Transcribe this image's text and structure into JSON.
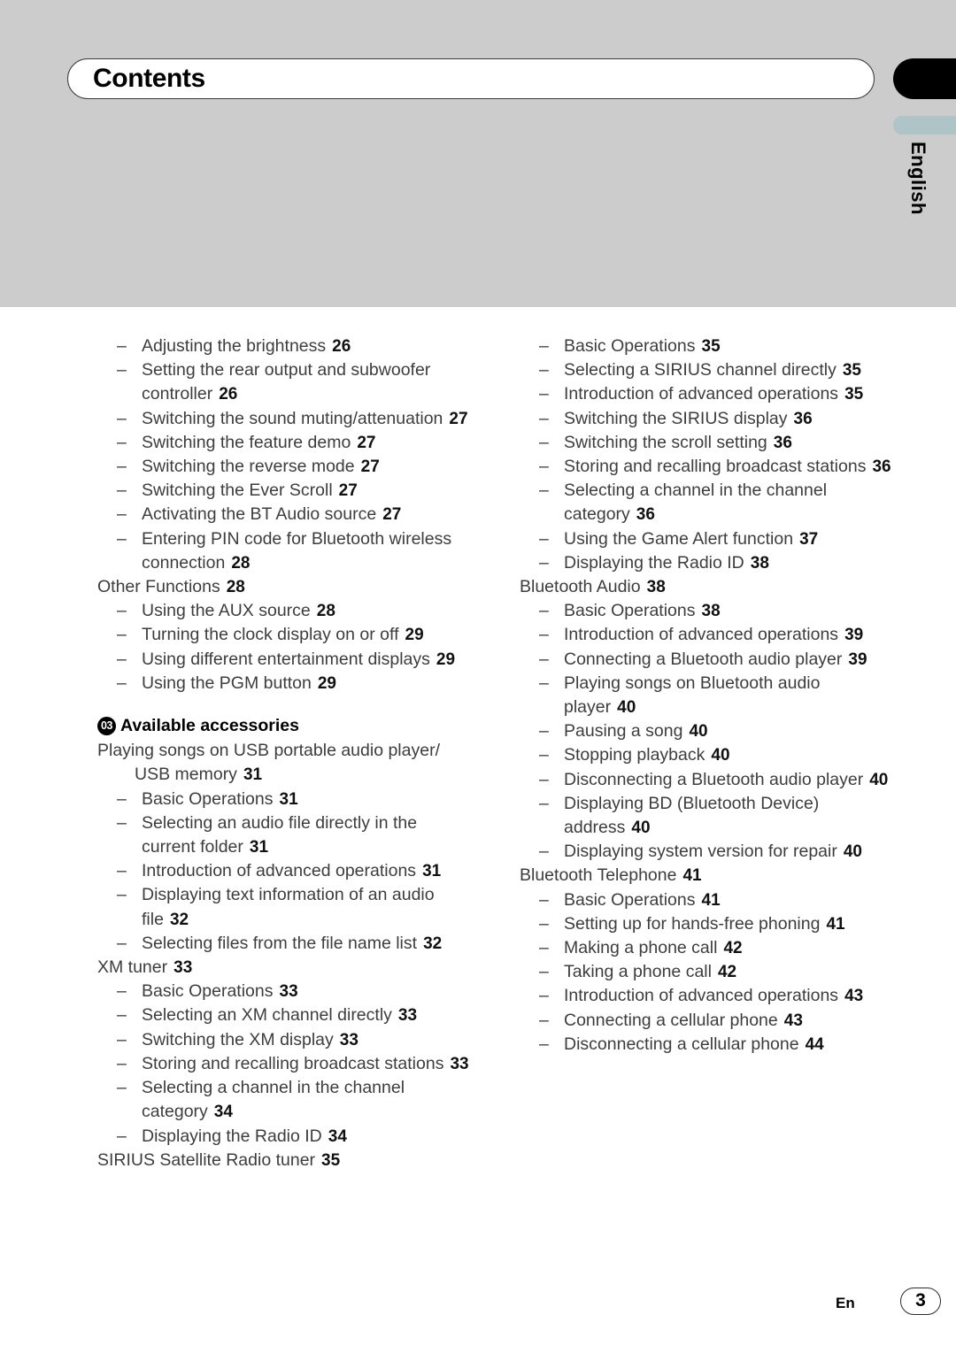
{
  "page": {
    "title": "Contents",
    "language_tab": "English",
    "footer_lang": "En",
    "footer_page": "3",
    "accent_black": "#000000",
    "accent_tab": "#aec4c6",
    "band_gray": "#cccccc"
  },
  "left_column": [
    {
      "level": 1,
      "text": "Adjusting the brightness",
      "page": "26"
    },
    {
      "level": 1,
      "text": "Setting the rear output and subwoofer controller",
      "page": "26"
    },
    {
      "level": 1,
      "text": "Switching the sound muting/attenuation",
      "page": "27"
    },
    {
      "level": 1,
      "text": "Switching the feature demo",
      "page": "27"
    },
    {
      "level": 1,
      "text": "Switching the reverse mode",
      "page": "27"
    },
    {
      "level": 1,
      "text": "Switching the Ever Scroll",
      "page": "27"
    },
    {
      "level": 1,
      "text": "Activating the BT Audio source",
      "page": "27"
    },
    {
      "level": 1,
      "text": "Entering PIN code for Bluetooth wireless connection",
      "page": "28"
    },
    {
      "level": 0,
      "text": "Other Functions",
      "page": "28"
    },
    {
      "level": 1,
      "text": "Using the AUX source",
      "page": "28"
    },
    {
      "level": 1,
      "text": "Turning the clock display on or off",
      "page": "29"
    },
    {
      "level": 1,
      "text": "Using different entertainment displays",
      "page": "29"
    },
    {
      "level": 1,
      "text": "Using the PGM button",
      "page": "29"
    },
    {
      "level": "chapter",
      "badge": "03",
      "text": "Available accessories",
      "page": ""
    },
    {
      "level": 0,
      "text": "Playing songs on USB portable audio player/ USB memory",
      "page": "31"
    },
    {
      "level": 1,
      "text": "Basic Operations",
      "page": "31"
    },
    {
      "level": 1,
      "text": "Selecting an audio file directly in the current folder",
      "page": "31"
    },
    {
      "level": 1,
      "text": "Introduction of advanced operations",
      "page": "31"
    },
    {
      "level": 1,
      "text": "Displaying text information of an audio file",
      "page": "32"
    },
    {
      "level": 1,
      "text": "Selecting files from the file name list",
      "page": "32"
    },
    {
      "level": 0,
      "text": "XM tuner",
      "page": "33"
    },
    {
      "level": 1,
      "text": "Basic Operations",
      "page": "33"
    },
    {
      "level": 1,
      "text": "Selecting an XM channel directly",
      "page": "33"
    },
    {
      "level": 1,
      "text": "Switching the XM display",
      "page": "33"
    },
    {
      "level": 1,
      "text": "Storing and recalling broadcast stations",
      "page": "33"
    },
    {
      "level": 1,
      "text": "Selecting a channel in the channel category",
      "page": "34"
    },
    {
      "level": 1,
      "text": "Displaying the Radio ID",
      "page": "34"
    },
    {
      "level": 0,
      "text": "SIRIUS Satellite Radio tuner",
      "page": "35"
    }
  ],
  "right_column": [
    {
      "level": 1,
      "text": "Basic Operations",
      "page": "35"
    },
    {
      "level": 1,
      "text": "Selecting a SIRIUS channel directly",
      "page": "35"
    },
    {
      "level": 1,
      "text": "Introduction of advanced operations",
      "page": "35"
    },
    {
      "level": 1,
      "text": "Switching the SIRIUS display",
      "page": "36"
    },
    {
      "level": 1,
      "text": "Switching the scroll setting",
      "page": "36"
    },
    {
      "level": 1,
      "text": "Storing and recalling broadcast stations",
      "page": "36"
    },
    {
      "level": 1,
      "text": "Selecting a channel in the channel category",
      "page": "36"
    },
    {
      "level": 1,
      "text": "Using the Game Alert function",
      "page": "37"
    },
    {
      "level": 1,
      "text": "Displaying the Radio ID",
      "page": "38"
    },
    {
      "level": 0,
      "text": "Bluetooth Audio",
      "page": "38"
    },
    {
      "level": 1,
      "text": "Basic Operations",
      "page": "38"
    },
    {
      "level": 1,
      "text": "Introduction of advanced operations",
      "page": "39"
    },
    {
      "level": 1,
      "text": "Connecting a Bluetooth audio player",
      "page": "39"
    },
    {
      "level": 1,
      "text": "Playing songs on Bluetooth audio player",
      "page": "40"
    },
    {
      "level": 1,
      "text": "Pausing a song",
      "page": "40"
    },
    {
      "level": 1,
      "text": "Stopping playback",
      "page": "40"
    },
    {
      "level": 1,
      "text": "Disconnecting a Bluetooth audio player",
      "page": "40"
    },
    {
      "level": 1,
      "text": "Displaying BD (Bluetooth Device) address",
      "page": "40"
    },
    {
      "level": 1,
      "text": "Displaying system version for repair",
      "page": "40"
    },
    {
      "level": 0,
      "text": "Bluetooth Telephone",
      "page": "41"
    },
    {
      "level": 1,
      "text": "Basic Operations",
      "page": "41"
    },
    {
      "level": 1,
      "text": "Setting up for hands-free phoning",
      "page": "41"
    },
    {
      "level": 1,
      "text": "Making a phone call",
      "page": "42"
    },
    {
      "level": 1,
      "text": "Taking a phone call",
      "page": "42"
    },
    {
      "level": 1,
      "text": "Introduction of advanced operations",
      "page": "43"
    },
    {
      "level": 1,
      "text": "Connecting a cellular phone",
      "page": "43"
    },
    {
      "level": 1,
      "text": "Disconnecting a cellular phone",
      "page": "44"
    }
  ]
}
